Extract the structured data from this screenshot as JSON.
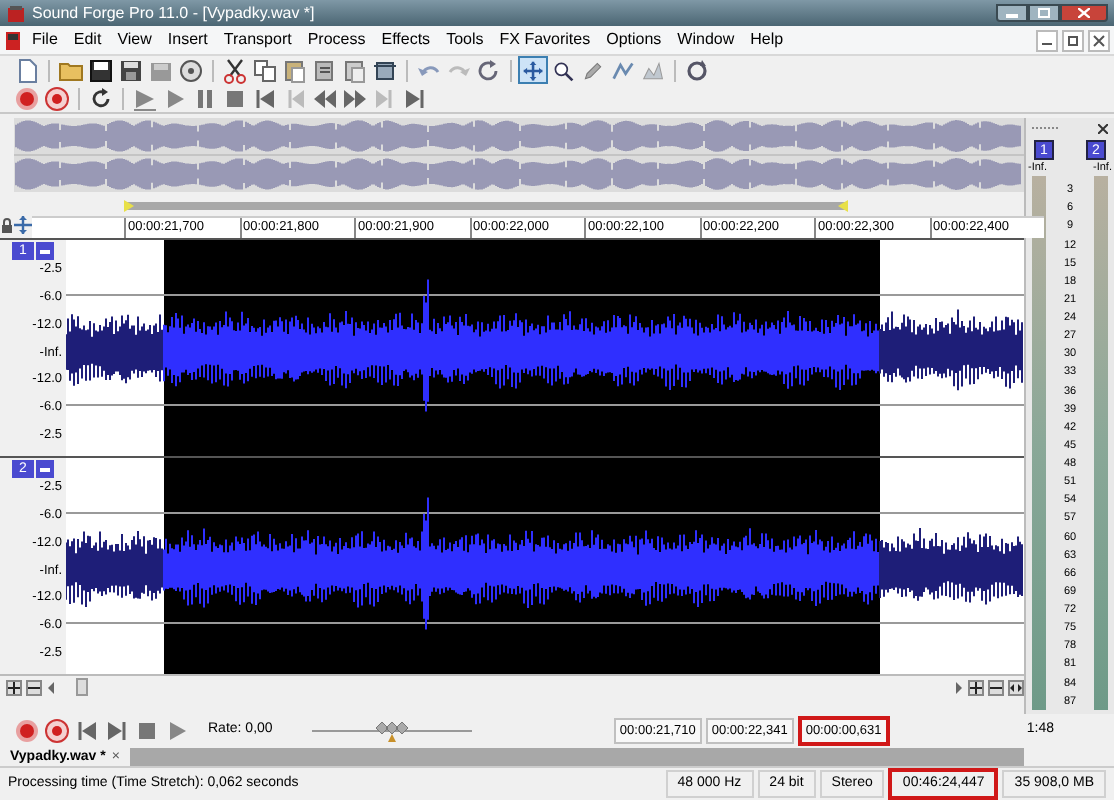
{
  "window": {
    "title": "Sound Forge Pro 11.0 - [Vypadky.wav *]"
  },
  "menu": [
    "File",
    "Edit",
    "View",
    "Insert",
    "Transport",
    "Process",
    "Effects",
    "Tools",
    "FX Favorites",
    "Options",
    "Window",
    "Help"
  ],
  "toolbar_tools": [
    {
      "kind": "edit",
      "selected": true
    },
    {
      "kind": "magnify",
      "selected": false
    },
    {
      "kind": "pencil",
      "selected": false
    },
    {
      "kind": "envelope",
      "selected": false
    },
    {
      "kind": "event",
      "selected": false
    }
  ],
  "ruler": {
    "ticks": [
      "00:00:21,700",
      "00:00:21,800",
      "00:00:21,900",
      "00:00:22,000",
      "00:00:22,100",
      "00:00:22,200",
      "00:00:22,300",
      "00:00:22,400"
    ]
  },
  "channels": [
    {
      "badge": "1",
      "db_labels": [
        "-2.5",
        "-6.0",
        "-12.0",
        "-Inf.",
        "-12.0",
        "-6.0",
        "-2.5"
      ]
    },
    {
      "badge": "2",
      "db_labels": [
        "-2.5",
        "-6.0",
        "-12.0",
        "-Inf.",
        "-12.0",
        "-6.0",
        "-2.5"
      ]
    }
  ],
  "meters": {
    "channels": [
      {
        "badge": "1",
        "peak": "-Inf."
      },
      {
        "badge": "2",
        "peak": "-Inf."
      }
    ],
    "scale": [
      "3",
      "6",
      "9",
      "12",
      "15",
      "18",
      "21",
      "24",
      "27",
      "30",
      "33",
      "36",
      "39",
      "42",
      "45",
      "48",
      "51",
      "54",
      "57",
      "60",
      "63",
      "66",
      "69",
      "72",
      "75",
      "78",
      "81",
      "84",
      "87"
    ]
  },
  "transport": {
    "rate": "Rate: 0,00",
    "rate_slider": {
      "level": 0.5
    },
    "times": [
      {
        "value": "00:00:21,710",
        "highlighted": false
      },
      {
        "value": "00:00:22,341",
        "highlighted": false
      },
      {
        "value": "00:00:00,631",
        "highlighted": true
      }
    ],
    "zoom": "1:48"
  },
  "tabs": [
    {
      "label": "Vypadky.wav *",
      "selected": true,
      "close": "×"
    }
  ],
  "status_bar": {
    "message": "Processing time (Time Stretch): 0,062 seconds",
    "fields": [
      {
        "value": "48 000 Hz",
        "highlighted": false
      },
      {
        "value": "24 bit",
        "highlighted": false
      },
      {
        "value": "Stereo",
        "highlighted": false
      },
      {
        "value": "00:46:24,447",
        "highlighted": true
      },
      {
        "value": "35 908,0 MB",
        "highlighted": false
      }
    ]
  }
}
